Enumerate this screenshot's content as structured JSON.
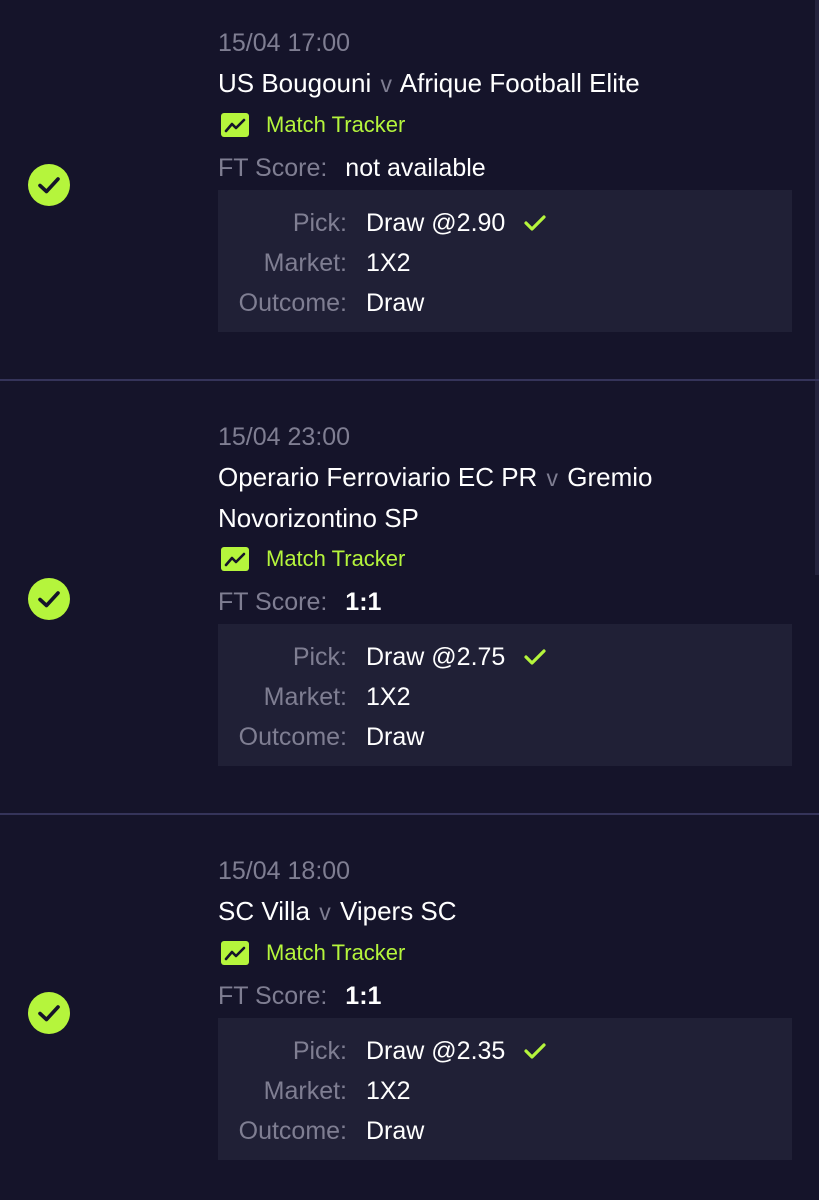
{
  "colors": {
    "background": "#15142a",
    "accent": "#b5f53c",
    "muted": "#7f7e92",
    "panel": "#202036",
    "divider": "#35345a"
  },
  "labels": {
    "match_tracker": "Match Tracker",
    "ft_score": "FT Score:",
    "pick": "Pick:",
    "market": "Market:",
    "outcome": "Outcome:"
  },
  "bets": [
    {
      "status_icon": "check-circle-icon",
      "time": "15/04 17:00",
      "home": "US Bougouni",
      "separator": "v",
      "away": "Afrique Football Elite",
      "ft_score": "not available",
      "pick": "Draw @2.90",
      "market": "1X2",
      "outcome": "Draw"
    },
    {
      "status_icon": "check-circle-icon",
      "time": "15/04 23:00",
      "home": "Operario Ferroviario EC PR",
      "separator": "v",
      "away": "Gremio Novorizontino SP",
      "ft_score": "1:1",
      "pick": "Draw @2.75",
      "market": "1X2",
      "outcome": "Draw"
    },
    {
      "status_icon": "check-circle-icon",
      "time": "15/04 18:00",
      "home": "SC Villa",
      "separator": "v",
      "away": "Vipers SC",
      "ft_score": "1:1",
      "pick": "Draw @2.35",
      "market": "1X2",
      "outcome": "Draw"
    }
  ]
}
